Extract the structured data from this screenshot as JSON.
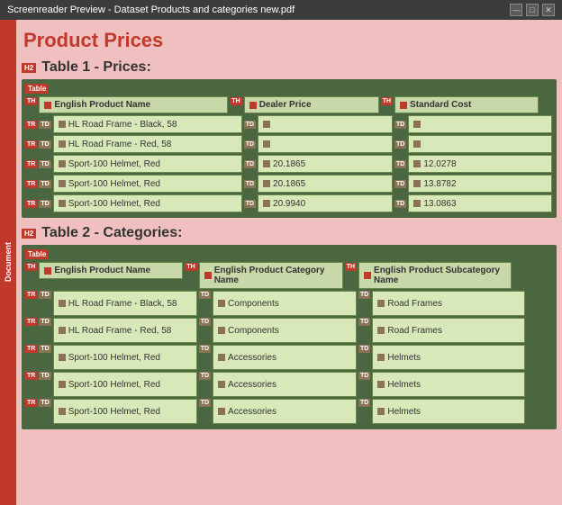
{
  "window": {
    "title": "Screenreader Preview - Dataset Products and categories new.pdf",
    "controls": [
      "—",
      "□",
      "✕"
    ]
  },
  "leftbar": {
    "label": "Document"
  },
  "page": {
    "title": "Product Prices"
  },
  "table1": {
    "section_tag": "H2",
    "title": "Table 1 - Prices:",
    "table_tag": "Table",
    "headers": [
      {
        "tag": "TH",
        "label": "English Product Name"
      },
      {
        "tag": "TH",
        "label": "Dealer Price"
      },
      {
        "tag": "TH",
        "label": "Standard Cost"
      }
    ],
    "rows": [
      {
        "tags": [
          "TR",
          "TD"
        ],
        "cells": [
          {
            "tag": "TD",
            "value": "HL Road Frame - Black, 58"
          },
          {
            "tag": "TD",
            "value": ""
          },
          {
            "tag": "TD",
            "value": ""
          }
        ]
      },
      {
        "tags": [
          "TR",
          "TD"
        ],
        "cells": [
          {
            "tag": "TD",
            "value": "HL Road Frame - Red, 58"
          },
          {
            "tag": "TD",
            "value": ""
          },
          {
            "tag": "TD",
            "value": ""
          }
        ]
      },
      {
        "tags": [
          "TR",
          "TD"
        ],
        "cells": [
          {
            "tag": "TD",
            "value": "Sport-100 Helmet, Red"
          },
          {
            "tag": "TD",
            "value": "20.1865"
          },
          {
            "tag": "TD",
            "value": "12.0278"
          }
        ]
      },
      {
        "tags": [
          "TR",
          "TD"
        ],
        "cells": [
          {
            "tag": "TD",
            "value": "Sport-100 Helmet, Red"
          },
          {
            "tag": "TD",
            "value": "20.1865"
          },
          {
            "tag": "TD",
            "value": "13.8782"
          }
        ]
      },
      {
        "tags": [
          "TR",
          "TD"
        ],
        "cells": [
          {
            "tag": "TD",
            "value": "Sport-100 Helmet, Red"
          },
          {
            "tag": "TD",
            "value": "20.9940"
          },
          {
            "tag": "TD",
            "value": "13.0863"
          }
        ]
      }
    ]
  },
  "table2": {
    "section_tag": "H2",
    "title": "Table 2 - Categories:",
    "table_tag": "Table",
    "headers": [
      {
        "tag": "TH",
        "label": "English Product Name"
      },
      {
        "tag": "TH",
        "label": "English Product Category Name"
      },
      {
        "tag": "TH",
        "label": "English Product Subcategory Name"
      }
    ],
    "rows": [
      {
        "tags": [
          "TR",
          "TD"
        ],
        "cells": [
          {
            "tag": "TD",
            "value": "HL Road Frame - Black, 58"
          },
          {
            "tag": "TD",
            "value": "Components"
          },
          {
            "tag": "TD",
            "value": "Road Frames"
          }
        ]
      },
      {
        "tags": [
          "TR",
          "TD"
        ],
        "cells": [
          {
            "tag": "TD",
            "value": "HL Road Frame - Red, 58"
          },
          {
            "tag": "TD",
            "value": "Components"
          },
          {
            "tag": "TD",
            "value": "Road Frames"
          }
        ]
      },
      {
        "tags": [
          "TR",
          "TD"
        ],
        "cells": [
          {
            "tag": "TD",
            "value": "Sport-100 Helmet, Red"
          },
          {
            "tag": "TD",
            "value": "Accessories"
          },
          {
            "tag": "TD",
            "value": "Helmets"
          }
        ]
      },
      {
        "tags": [
          "TR",
          "TD"
        ],
        "cells": [
          {
            "tag": "TD",
            "value": "Sport-100 Helmet, Red"
          },
          {
            "tag": "TD",
            "value": "Accessories"
          },
          {
            "tag": "TD",
            "value": "Helmets"
          }
        ]
      },
      {
        "tags": [
          "TR",
          "TD"
        ],
        "cells": [
          {
            "tag": "TD",
            "value": "Sport-100 Helmet, Red"
          },
          {
            "tag": "TD",
            "value": "Accessories"
          },
          {
            "tag": "TD",
            "value": "Helmets"
          }
        ]
      }
    ]
  }
}
